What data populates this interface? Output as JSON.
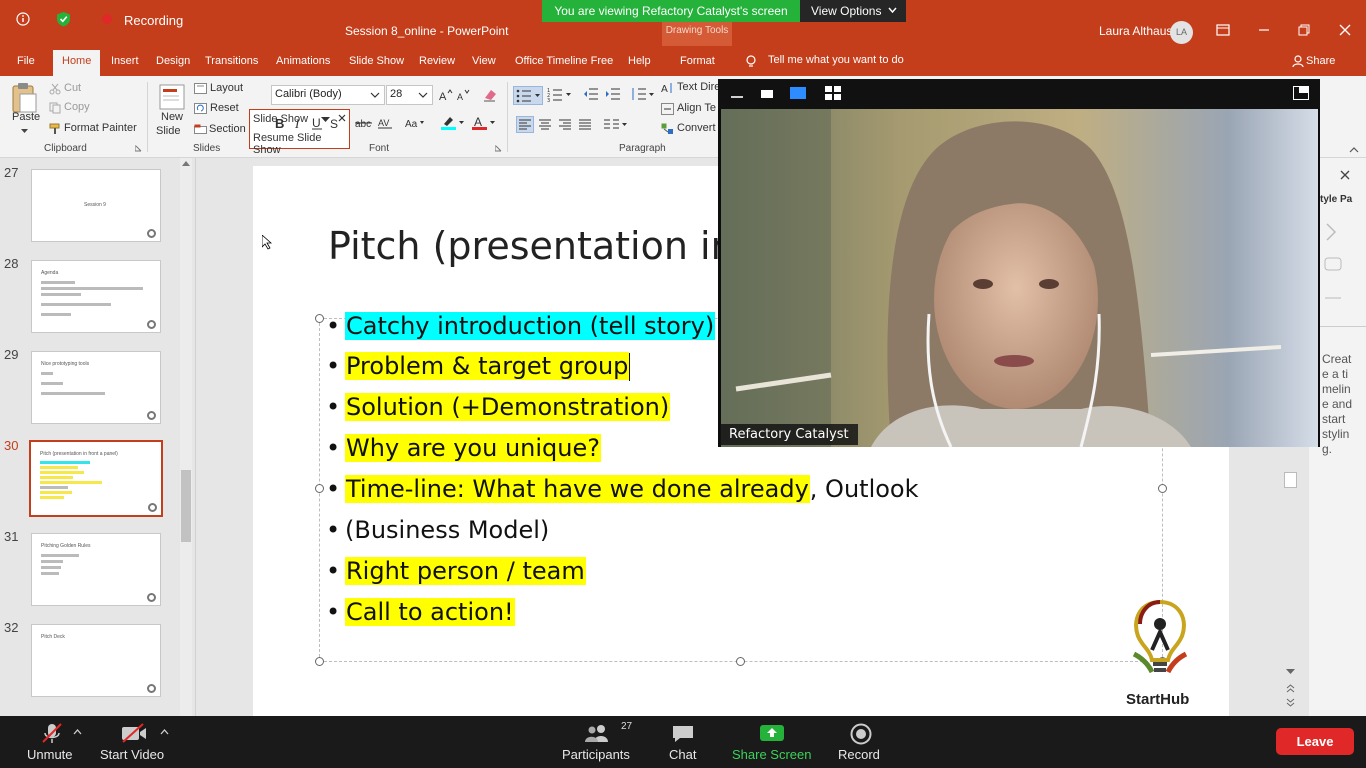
{
  "app": {
    "doc_title": "Session 8_online  -  PowerPoint",
    "drawing_tools": "Drawing Tools",
    "user_name": "Laura Althaus",
    "user_initials": "LA"
  },
  "zoom_top": {
    "recording_label": "Recording",
    "viewing_banner": "You are viewing Refactory Catalyst's screen",
    "view_options": "View Options"
  },
  "menu": {
    "tabs": [
      "File",
      "Home",
      "Insert",
      "Design",
      "Transitions",
      "Animations",
      "Slide Show",
      "Review",
      "View",
      "Office Timeline Free",
      "Help",
      "Format"
    ],
    "tell_me": "Tell me what you want to do",
    "share": "Share"
  },
  "ribbon": {
    "paste": "Paste",
    "cut": "Cut",
    "copy": "Copy",
    "format_painter": "Format Painter",
    "clipboard": "Clipboard",
    "new_slide_1": "New",
    "new_slide_2": "Slide",
    "layout": "Layout",
    "reset": "Reset",
    "section": "Section",
    "slides": "Slides",
    "font_name": "Calibri (Body)",
    "font_size": "28",
    "font": "Font",
    "paragraph": "Paragraph",
    "text_direction": "Text Dire",
    "align_text": "Align Te",
    "convert": "Convert",
    "popup_combo": "Slide Show",
    "popup_item": "Resume Slide Show"
  },
  "thumbnails": [
    {
      "num": "27",
      "title": "Session 9"
    },
    {
      "num": "28",
      "title": "Agenda"
    },
    {
      "num": "29",
      "title": "Nice prototyping tools"
    },
    {
      "num": "30",
      "title": "Pitch (presentation in front a panel)"
    },
    {
      "num": "31",
      "title": "Pitching Golden Rules"
    },
    {
      "num": "32",
      "title": "Pitch Deck"
    }
  ],
  "slide": {
    "title": "Pitch (presentation in",
    "bullets": [
      {
        "text": "Catchy introduction (tell story)",
        "rest": "",
        "hl": "c"
      },
      {
        "text": "Problem & target group",
        "rest": "",
        "hl": "y"
      },
      {
        "text": "Solution (+Demonstration)",
        "rest": "",
        "hl": "y"
      },
      {
        "text": "Why are you unique?",
        "rest": "",
        "hl": "y"
      },
      {
        "text": "Time-line: What have we done already",
        "rest": ", Outlook",
        "hl": "y"
      },
      {
        "text": "(Business Model)",
        "rest": "",
        "hl": ""
      },
      {
        "text": "Right person / team",
        "rest": "",
        "hl": "y"
      },
      {
        "text": "Call to action!",
        "rest": "",
        "hl": "y"
      }
    ],
    "logo_text": "StartHub"
  },
  "right_pane": {
    "title": "tyle Pa",
    "text": "Create a timeline and start styling."
  },
  "video": {
    "participant_name": "Refactory Catalyst"
  },
  "zoom_bar": {
    "unmute": "Unmute",
    "start_video": "Start Video",
    "participants": "Participants",
    "participant_count": "27",
    "chat": "Chat",
    "share_screen": "Share Screen",
    "record": "Record",
    "leave": "Leave"
  },
  "colors": {
    "ppt_brand": "#c43e1c",
    "zoom_green": "#24b23b",
    "leave_red": "#e02828",
    "highlight_yellow": "#ffff00",
    "highlight_cyan": "#00ffff"
  }
}
